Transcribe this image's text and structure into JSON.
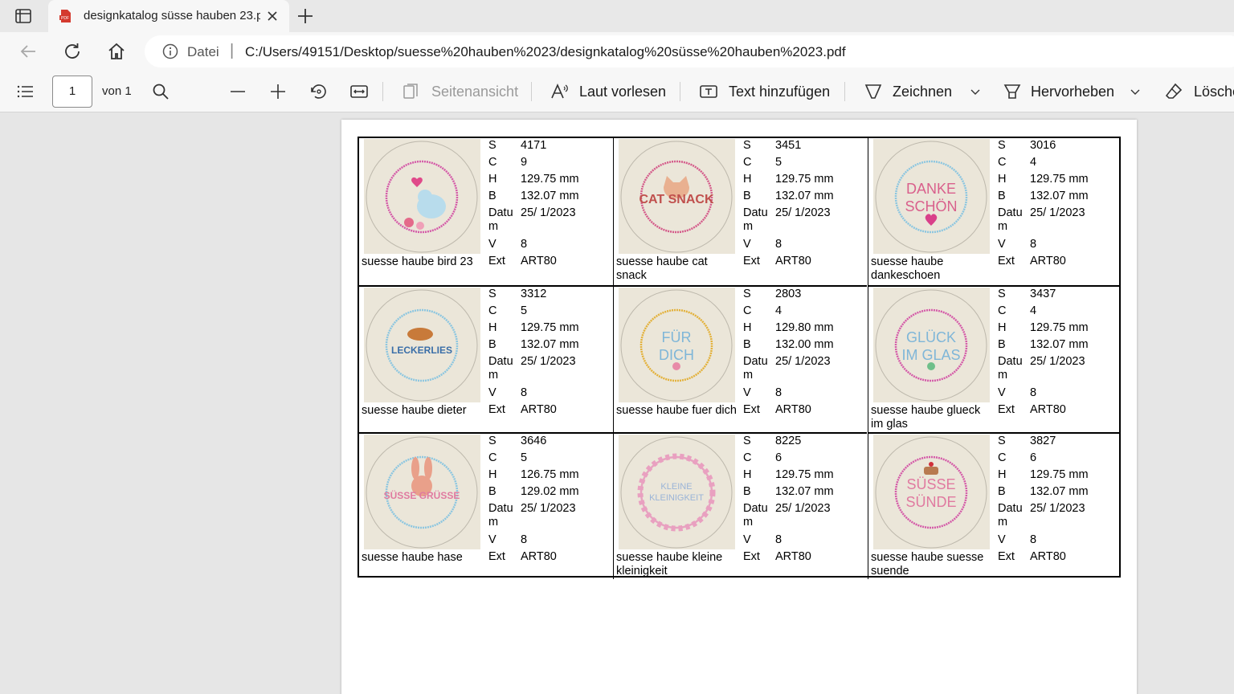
{
  "browser": {
    "tab_title": "designkatalog süsse hauben 23.p",
    "url_scheme": "Datei",
    "url": "C:/Users/49151/Desktop/suesse%20hauben%2023/designkatalog%20süsse%20hauben%2023.pdf"
  },
  "toolbar": {
    "page_number": "1",
    "page_of": "von 1",
    "page_view": "Seitenansicht",
    "read_aloud": "Laut vorlesen",
    "add_text": "Text hinzufügen",
    "draw": "Zeichnen",
    "highlight": "Hervorheben",
    "erase": "Lösche"
  },
  "labels": {
    "s": "S",
    "c": "C",
    "h": "H",
    "b": "B",
    "datum1": "Datu",
    "datum2": "m",
    "v": "V",
    "ext": "Ext"
  },
  "designs": [
    {
      "name": "suesse haube bird 23",
      "s": "4171",
      "c": "9",
      "h": "129.75 mm",
      "b": "132.07 mm",
      "date": "25/ 1/2023",
      "v": "8",
      "ext": "ART80",
      "art": "bird"
    },
    {
      "name": "suesse haube cat snack",
      "s": "3451",
      "c": "5",
      "h": "129.75 mm",
      "b": "132.07 mm",
      "date": "25/ 1/2023",
      "v": "8",
      "ext": "ART80",
      "art_text": [
        "CAT SNACK"
      ]
    },
    {
      "name": "suesse haube dankeschoen",
      "s": "3016",
      "c": "4",
      "h": "129.75 mm",
      "b": "132.07 mm",
      "date": "25/ 1/2023",
      "v": "8",
      "ext": "ART80",
      "art_text": [
        "DANKE",
        "SCHÖN"
      ]
    },
    {
      "name": "suesse haube dieter",
      "s": "3312",
      "c": "5",
      "h": "129.75 mm",
      "b": "132.07 mm",
      "date": "25/ 1/2023",
      "v": "8",
      "ext": "ART80",
      "art_text": [
        "LECKERLIES"
      ]
    },
    {
      "name": "suesse haube fuer dich",
      "s": "2803",
      "c": "4",
      "h": "129.80 mm",
      "b": "132.00 mm",
      "date": "25/ 1/2023",
      "v": "8",
      "ext": "ART80",
      "art_text": [
        "FÜR",
        "DICH"
      ]
    },
    {
      "name": "suesse haube glueck im glas",
      "s": "3437",
      "c": "4",
      "h": "129.75 mm",
      "b": "132.07 mm",
      "date": "25/ 1/2023",
      "v": "8",
      "ext": "ART80",
      "art_text": [
        "GLÜCK",
        "IM GLAS"
      ]
    },
    {
      "name": "suesse haube hase",
      "s": "3646",
      "c": "5",
      "h": "126.75 mm",
      "b": "129.02 mm",
      "date": "25/ 1/2023",
      "v": "8",
      "ext": "ART80",
      "art_text": [
        "SÜSSE GRÜSSE"
      ]
    },
    {
      "name": "suesse haube kleine kleinigkeit",
      "s": "8225",
      "c": "6",
      "h": "129.75 mm",
      "b": "132.07 mm",
      "date": "25/ 1/2023",
      "v": "8",
      "ext": "ART80",
      "art_text": [
        "KLEINE",
        "KLEINIGKEIT"
      ]
    },
    {
      "name": "suesse haube suesse suende",
      "s": "3827",
      "c": "6",
      "h": "129.75 mm",
      "b": "132.07 mm",
      "date": "25/ 1/2023",
      "v": "8",
      "ext": "ART80",
      "art_text": [
        "SÜSSE",
        "SÜNDE"
      ]
    }
  ]
}
